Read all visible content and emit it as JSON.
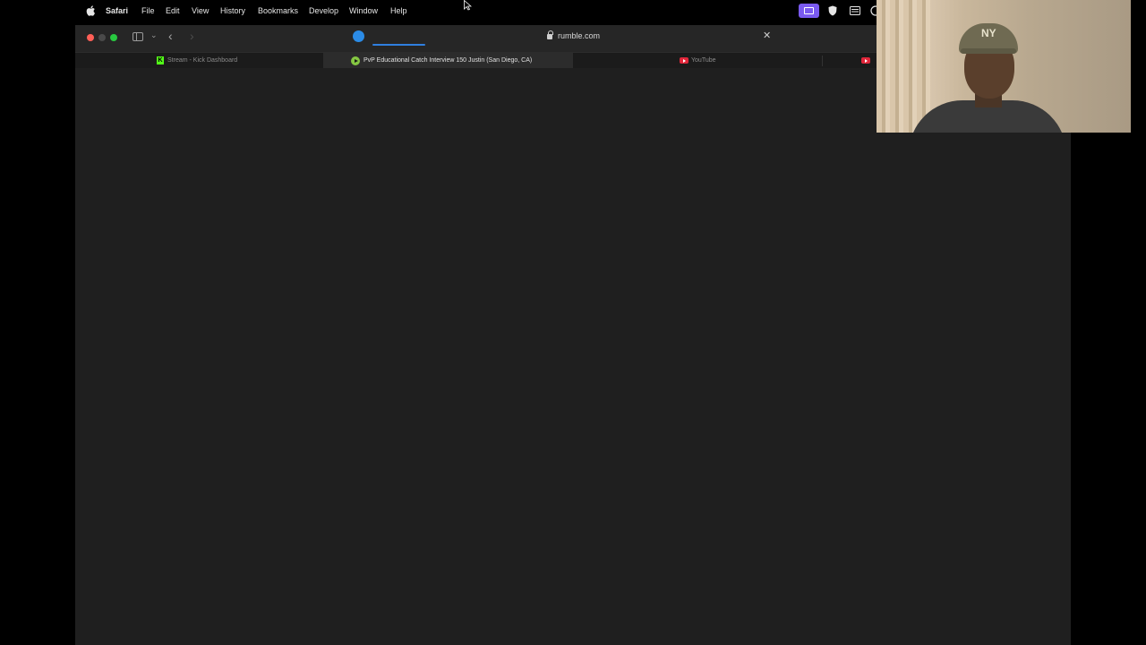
{
  "menubar": {
    "app_name": "Safari",
    "items": [
      "File",
      "Edit",
      "View",
      "History",
      "Bookmarks",
      "Develop",
      "Window",
      "Help"
    ],
    "status_icons": [
      "screen-share-icon",
      "shield-icon",
      "keyboard-icon",
      "clock-icon"
    ]
  },
  "toolbar": {
    "back_glyph": "‹",
    "forward_glyph": "›",
    "chevron_glyph": "⌄",
    "url": "rumble.com",
    "stop_glyph": "✕",
    "loading_progress": 0.13
  },
  "tabs": [
    {
      "title": "Stream - Kick Dashboard",
      "favicon": "kick-icon",
      "active": false
    },
    {
      "title": "PvP Educational Catch Interview 150 Justin (San Diego, CA)",
      "favicon": "rumble-icon",
      "active": true
    },
    {
      "title": "YouTube",
      "favicon": "youtube-icon",
      "active": false
    },
    {
      "title": "",
      "favicon": "youtube-icon",
      "active": false
    }
  ],
  "colors": {
    "menubar_bg": "#000000",
    "window_bg": "#1f1f1f",
    "accent_loading": "#2f7fe0",
    "kick_green": "#53fc18",
    "rumble_green": "#85c742",
    "youtube_red": "#e0263a",
    "status_purple": "#7a5af0"
  },
  "webcam": {
    "cap_logo": "NY"
  }
}
